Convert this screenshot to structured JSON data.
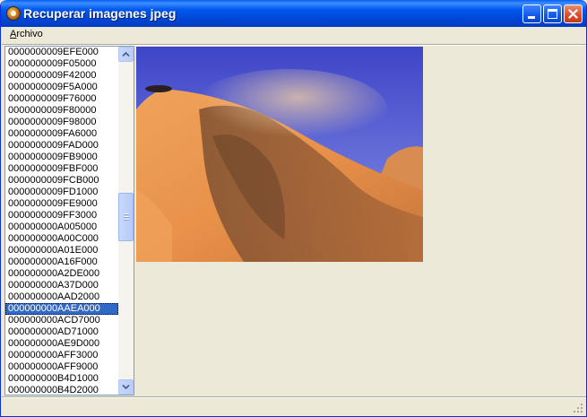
{
  "window": {
    "title": "Recuperar imagenes jpeg"
  },
  "menu": {
    "archivo_first": "A",
    "archivo_rest": "rchivo"
  },
  "list": {
    "items": [
      "0000000009EFE000",
      "0000000009F05000",
      "0000000009F42000",
      "0000000009F5A000",
      "0000000009F76000",
      "0000000009F80000",
      "0000000009F98000",
      "0000000009FA6000",
      "0000000009FAD000",
      "0000000009FB9000",
      "0000000009FBF000",
      "0000000009FCB000",
      "0000000009FD1000",
      "0000000009FE9000",
      "0000000009FF3000",
      "000000000A005000",
      "000000000A00C000",
      "000000000A01E000",
      "000000000A16F000",
      "000000000A2DE000",
      "000000000A37D000",
      "000000000AAD2000",
      "000000000AAEA000",
      "000000000ACD7000",
      "000000000AD71000",
      "000000000AE9D000",
      "000000000AFF3000",
      "000000000AFF9000",
      "000000000B4D1000",
      "000000000B4D2000"
    ],
    "selected_index": 22,
    "scroll_position": 0.42
  },
  "icons": {
    "app": "app-icon",
    "minimize": "minimize-icon",
    "maximize": "maximize-icon",
    "close": "close-icon",
    "scroll_up": "arrow-up-icon",
    "scroll_down": "arrow-down-icon",
    "size_grip": "size-grip-icon"
  },
  "colors": {
    "titlebar": "#0054e3",
    "selection": "#316ac5",
    "face": "#ece9d8"
  }
}
